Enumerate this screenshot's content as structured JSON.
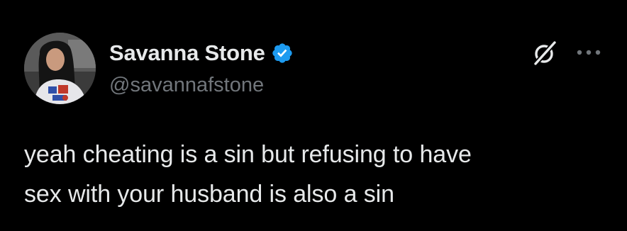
{
  "tweet": {
    "author": {
      "display_name": "Savanna Stone",
      "handle": "@savannafstone",
      "verified": true,
      "avatar_icon": "profile-photo"
    },
    "actions": {
      "grok_icon": "grok-icon",
      "more_icon": "more-horizontal-icon"
    },
    "text_lines": [
      "yeah cheating is a sin but refusing to have",
      "sex with your husband is also a sin"
    ]
  },
  "colors": {
    "background": "#000000",
    "text_primary": "#e7e9ea",
    "text_secondary": "#71767b",
    "verified_blue": "#1d9bf0"
  }
}
